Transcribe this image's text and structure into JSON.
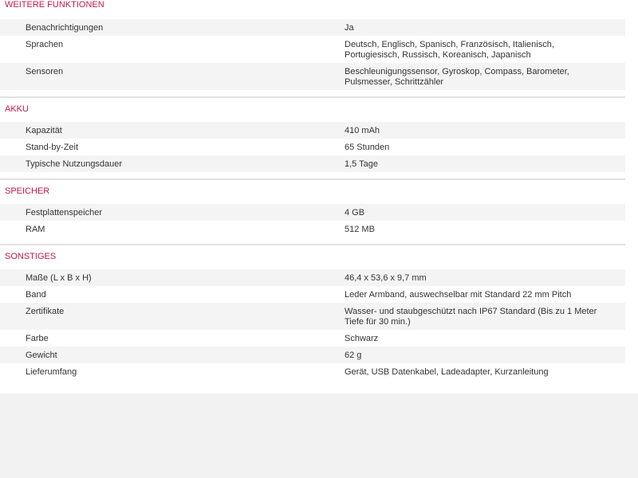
{
  "sections": [
    {
      "title": "WEITERE FUNKTIONEN",
      "rows": [
        {
          "label": "Benachrichtigungen",
          "value": "Ja"
        },
        {
          "label": "Sprachen",
          "value": "Deutsch, Englisch, Spanisch, Französisch, Italienisch, Portugiesisch, Russisch, Koreanisch, Japanisch"
        },
        {
          "label": "Sensoren",
          "value": "Beschleunigungssensor, Gyroskop, Compass, Barometer, Pulsmesser, Schrittzähler"
        }
      ]
    },
    {
      "title": "AKKU",
      "rows": [
        {
          "label": "Kapazität",
          "value": "410 mAh"
        },
        {
          "label": "Stand-by-Zeit",
          "value": "65 Stunden"
        },
        {
          "label": "Typische Nutzungsdauer",
          "value": "1,5 Tage"
        }
      ]
    },
    {
      "title": "SPEICHER",
      "rows": [
        {
          "label": "Festplattenspeicher",
          "value": "4 GB"
        },
        {
          "label": "RAM",
          "value": "512 MB"
        }
      ]
    },
    {
      "title": "SONSTIGES",
      "rows": [
        {
          "label": "Maße (L x B x H)",
          "value": "46,4 x 53,6 x 9,7 mm"
        },
        {
          "label": "Band",
          "value": "Leder Armband, auswechselbar mit Standard 22 mm Pitch"
        },
        {
          "label": "Zertifikate",
          "value": "Wasser- und staubgeschützt nach IP67 Standard (Bis zu 1 Meter Tiefe für 30 min.)"
        },
        {
          "label": "Farbe",
          "value": "Schwarz"
        },
        {
          "label": "Gewicht",
          "value": "62 g"
        },
        {
          "label": "Lieferumfang",
          "value": "Gerät, USB Datenkabel, Ladeadapter, Kurzanleitung"
        }
      ]
    }
  ],
  "colors": {
    "section_title": "#c8174a",
    "row_stripe": "#f4f4f4",
    "divider": "#e2e2e2",
    "footer_band": "#f2f2f2"
  }
}
